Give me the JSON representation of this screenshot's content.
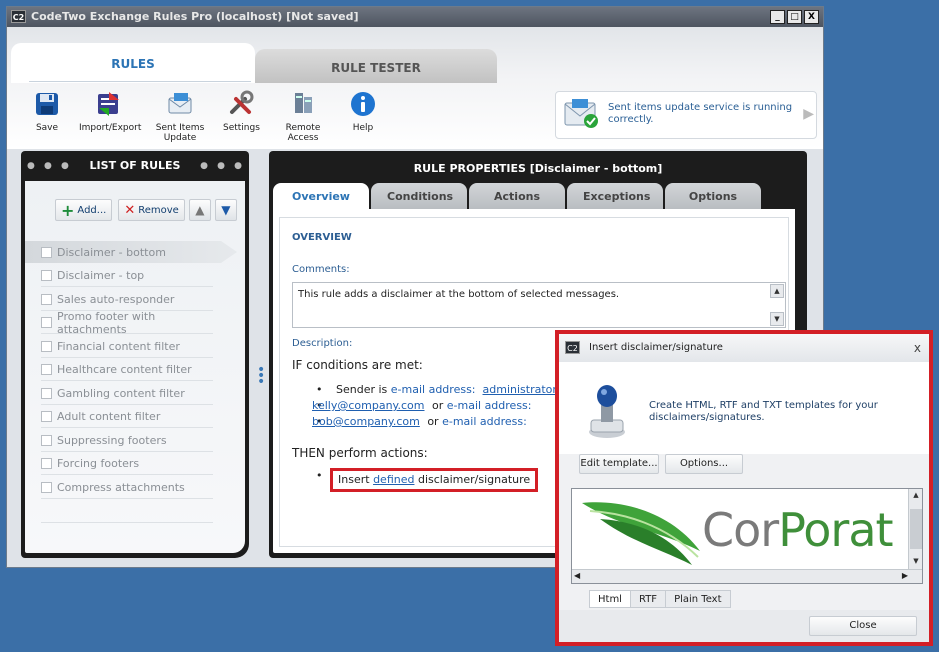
{
  "window": {
    "app_icon": "C2",
    "title": "CodeTwo Exchange Rules Pro (localhost) [Not saved]",
    "controls": [
      "_",
      "□",
      "X"
    ]
  },
  "main_tabs": [
    {
      "label": "RULES",
      "active": true
    },
    {
      "label": "RULE TESTER",
      "active": false
    }
  ],
  "toolbar": {
    "items": [
      {
        "label": "Save",
        "icon": "floppy-disk-icon"
      },
      {
        "label": "Import/Export",
        "icon": "import-export-icon"
      },
      {
        "label": "Sent Items Update",
        "icon": "sent-items-icon"
      },
      {
        "label": "Settings",
        "icon": "tools-icon"
      },
      {
        "label": "Remote Access",
        "icon": "server-icon"
      },
      {
        "label": "Help",
        "icon": "info-icon"
      }
    ]
  },
  "status": {
    "text": "Sent items update service is running correctly.",
    "icon": "envelope-check-icon"
  },
  "rules_list": {
    "title": "LIST OF RULES",
    "add_label": "Add...",
    "remove_label": "Remove",
    "items": [
      {
        "label": "Disclaimer - bottom",
        "selected": true
      },
      {
        "label": "Disclaimer - top"
      },
      {
        "label": "Sales auto-responder"
      },
      {
        "label": "Promo footer with attachments"
      },
      {
        "label": "Financial content filter"
      },
      {
        "label": "Healthcare content filter"
      },
      {
        "label": "Gambling content filter"
      },
      {
        "label": "Adult content filter"
      },
      {
        "label": "Suppressing footers"
      },
      {
        "label": "Forcing footers"
      },
      {
        "label": "Compress attachments"
      }
    ]
  },
  "rule_properties": {
    "title": "RULE PROPERTIES [Disclaimer - bottom]",
    "tabs": [
      {
        "label": "Overview",
        "active": true
      },
      {
        "label": "Conditions"
      },
      {
        "label": "Actions"
      },
      {
        "label": "Exceptions"
      },
      {
        "label": "Options"
      }
    ],
    "section_title": "OVERVIEW",
    "comments_label": "Comments:",
    "comments_value": "This rule adds a disclaimer at the bottom of selected messages.",
    "description_label": "Description:",
    "if_text": "IF conditions are met:",
    "sender_is": "Sender is",
    "email_address": "e-mail address:",
    "or_text": "or",
    "addr1": "administrator@",
    "addr2": "kelly@company.com",
    "addr3": "bob@company.com",
    "then_text": "THEN perform actions:",
    "insert_text": "Insert",
    "defined_link": "defined",
    "disclaimer_text": "disclaimer/signature"
  },
  "popup": {
    "app_icon": "C2",
    "title": "Insert disclaimer/signature",
    "close_glyph": "x",
    "description": "Create HTML, RTF and TXT templates for your disclaimers/signatures.",
    "edit_label": "Edit template...",
    "options_label": "Options...",
    "preview_text_grey": "Cor",
    "preview_text_green": "Porat",
    "format_tabs": [
      {
        "label": "Html",
        "active": true
      },
      {
        "label": "RTF"
      },
      {
        "label": "Plain Text"
      }
    ],
    "close_label": "Close"
  }
}
